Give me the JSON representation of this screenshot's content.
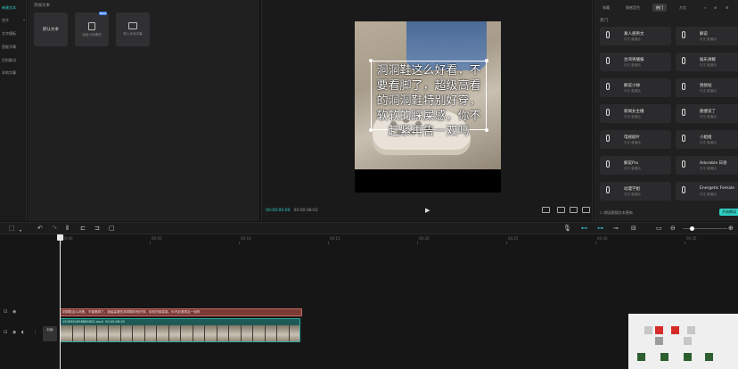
{
  "left_rail": {
    "items": [
      {
        "label": "新建文本",
        "active": true
      },
      {
        "label": "花字",
        "caret": true
      },
      {
        "label": "文字模板"
      },
      {
        "label": "智能字幕"
      },
      {
        "label": "识别歌词"
      },
      {
        "label": "本地字幕"
      }
    ]
  },
  "library": {
    "title": "添加文本",
    "cards": [
      {
        "label": "默认文本"
      },
      {
        "label": "花字 ",
        "sub": "添加小说素材",
        "badge": "NEW"
      },
      {
        "label": "",
        "sub": "导入本地字幕"
      }
    ]
  },
  "preview": {
    "caption": "洞洞鞋这么好看，不要看脚了，超级高看的洞洞鞋特别好穿，软软的踩屎感，你不赶紧再告一双吗",
    "current_time": "00:00:00:00",
    "total_time": "00:00:08:02",
    "ratio_label": "比例",
    "controls": [
      "原始",
      "全屏",
      "缩放"
    ]
  },
  "right_panel": {
    "tabs": [
      "收藏",
      "情感音色",
      "热门",
      "方言"
    ],
    "active_tab": "热门",
    "section": "热门",
    "voices": [
      {
        "name": "真人感男文",
        "sub": "中文·普通话"
      },
      {
        "name": "解说",
        "sub": "中文·普通话"
      },
      {
        "name": "台湾男播报",
        "sub": "中文·普通话"
      },
      {
        "name": "娱乐讲解",
        "sub": "中文·普通话"
      },
      {
        "name": "解说小帅",
        "sub": "中文·普通话"
      },
      {
        "name": "悦悦哒",
        "sub": "中文·普通话"
      },
      {
        "name": "新闻女主播",
        "sub": "中文·普通话"
      },
      {
        "name": "随便说了",
        "sub": "中文·普通话"
      },
      {
        "name": "电视剧片",
        "sub": "中文·普通话"
      },
      {
        "name": "小姐姐",
        "sub": "中文·普通话"
      },
      {
        "name": "解说Pro",
        "sub": "中文·普通话"
      },
      {
        "name": "Adorable 日语",
        "sub": "中文·普通话"
      },
      {
        "name": "动漫学姐",
        "sub": "中文·普通话"
      },
      {
        "name": "Energetic Female",
        "sub": "中文·普通话"
      }
    ],
    "bottom_label": "朗读跟随文本更新",
    "bottom_button": "开始朗读"
  },
  "toolbar": {
    "icons": [
      "select-icon",
      "undo-icon",
      "redo-icon",
      "split-icon",
      "split-left-icon",
      "split-right-icon",
      "delete-icon"
    ]
  },
  "timeline": {
    "ticks": [
      "00:00",
      "00:05",
      "00:10",
      "00:15",
      "00:20",
      "00:25",
      "00:30",
      "00:35",
      "00:40",
      "00:45"
    ],
    "text_clip": "洞洞鞋这么好看，不要看脚了，超级高看的洞洞鞋特别好穿，软软的踩屎感，你不赶紧再告一双吗",
    "video_clip_name": "1545991898885852.mp4",
    "video_clip_duration": "00:00:08:02",
    "cover_label": "封面"
  },
  "colors": {
    "accent": "#2fd1c4",
    "text_clip": "#7b3a36",
    "video_clip": "#1e5a56"
  }
}
